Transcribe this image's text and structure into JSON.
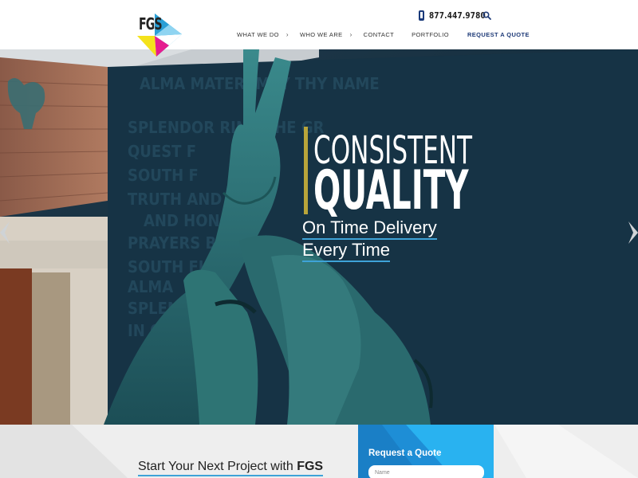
{
  "header": {
    "logo_text": "FGS",
    "phone": "877.447.9780",
    "nav": [
      {
        "label": "WHAT WE DO"
      },
      {
        "label": "WHO WE ARE"
      },
      {
        "label": "CONTACT"
      },
      {
        "label": "PORTFOLIO"
      },
      {
        "label": "REQUEST A QUOTE"
      }
    ]
  },
  "hero": {
    "line1": "CONSISTENT",
    "line2": "QUALITY",
    "sub1": "On Time Delivery",
    "sub2": "Every Time",
    "wall_text": [
      "ALMA MATER, MAY THY NAME",
      "SPLENDOR RING THE GR",
      "QUEST F",
      "SOUTH F",
      "TRUTH AND",
      "AND HONO",
      "PRAYERS B",
      "SOUTH FL",
      "ALMA",
      "SPLENDOR",
      "IN QU"
    ]
  },
  "bottom": {
    "start_prefix": "Start Your Next Project with ",
    "start_brand": "FGS"
  },
  "quote_form": {
    "title": "Request a Quote",
    "name_placeholder": "Name"
  },
  "colors": {
    "brand_blue": "#1f3b78",
    "accent_blue": "#3ea3d8",
    "gold": "#b9a53a",
    "panel_blue": "#1e9ee0"
  }
}
